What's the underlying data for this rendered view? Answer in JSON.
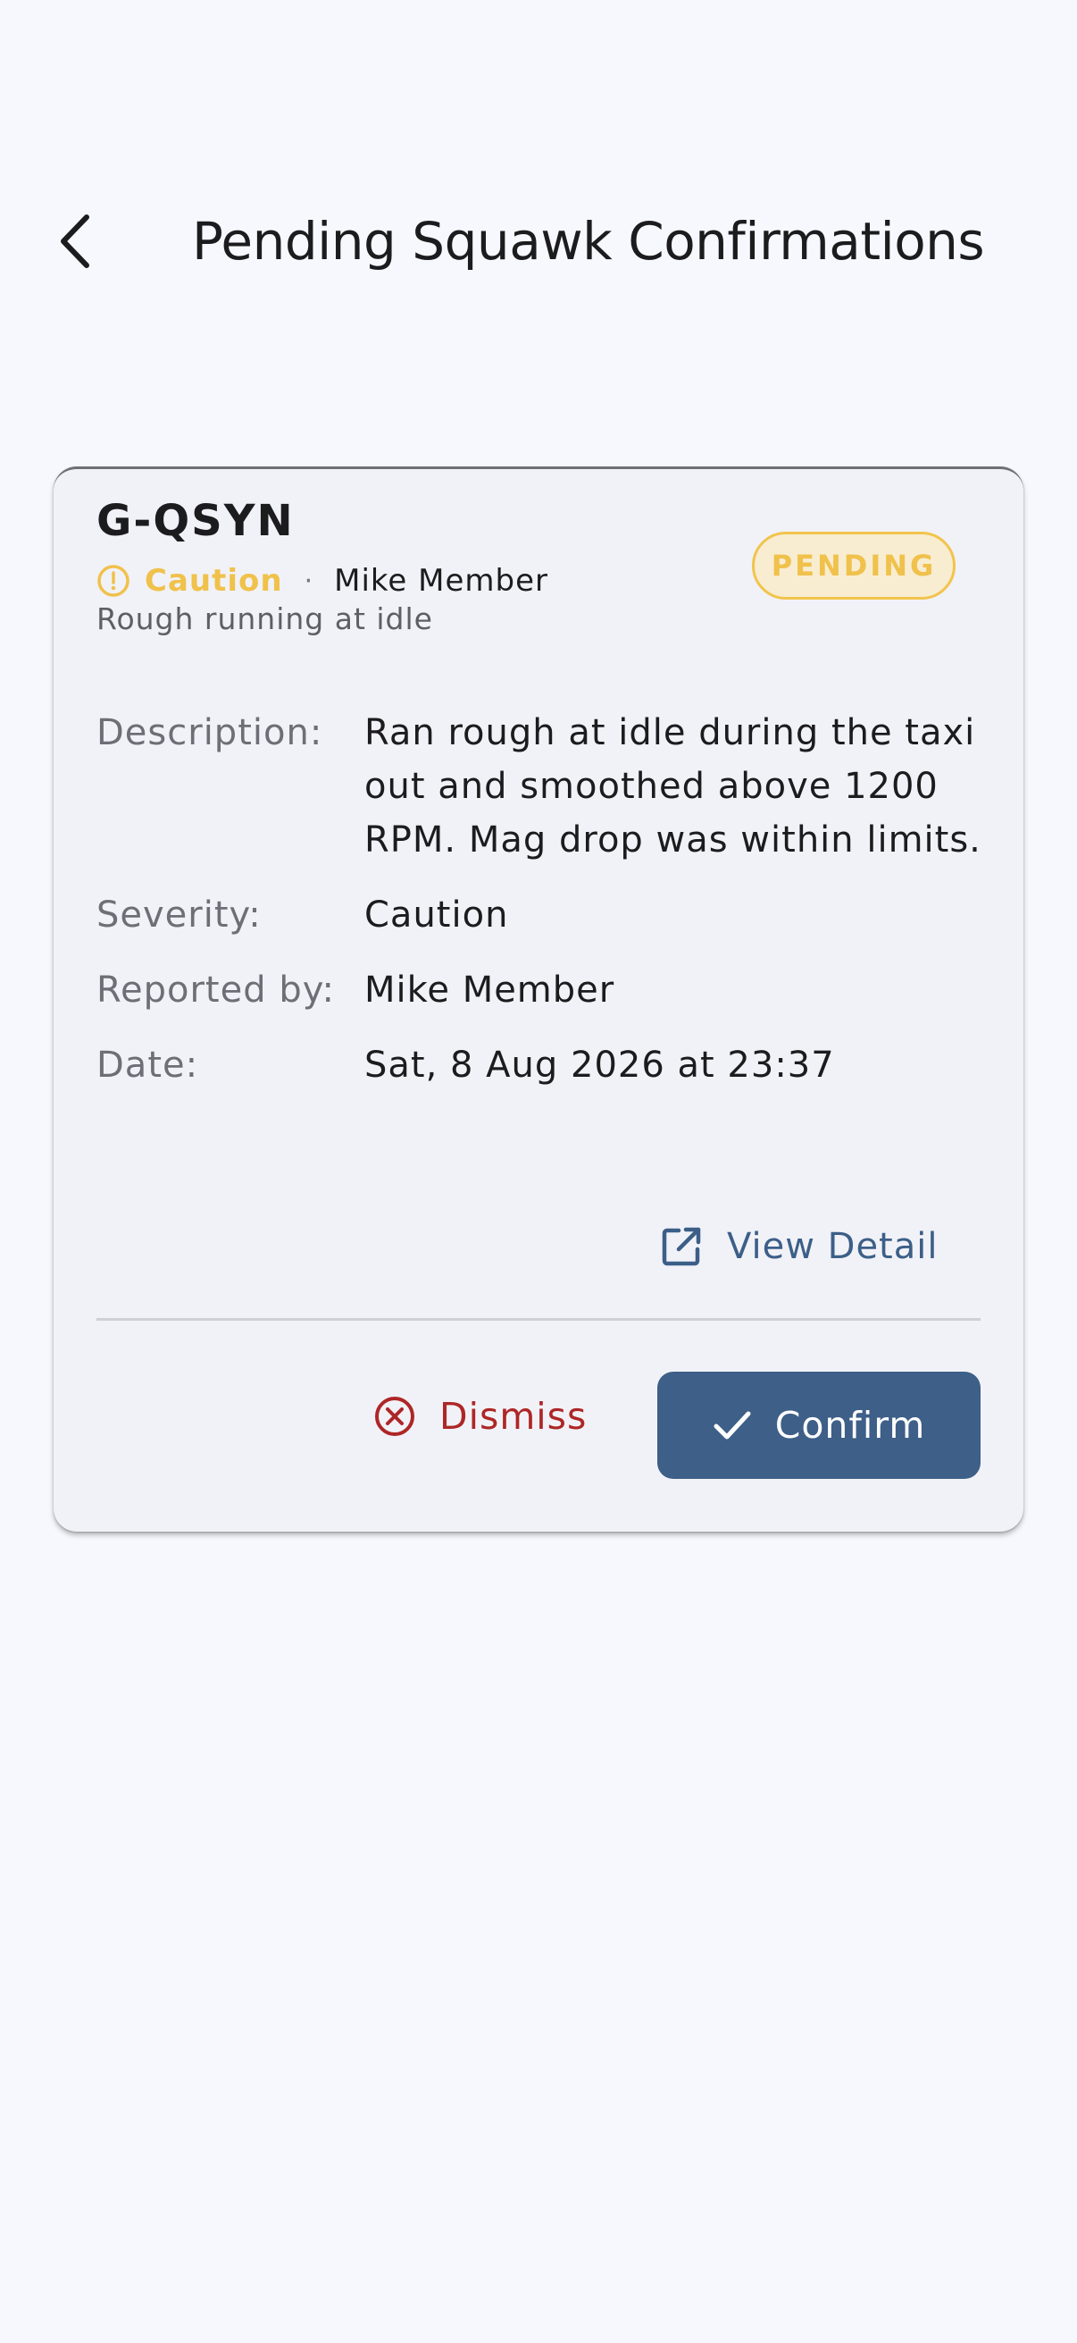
{
  "header": {
    "title": "Pending Squawk Confirmations",
    "back_icon": "chevron-left-icon"
  },
  "squawk": {
    "tail_number": "G-QSYN",
    "severity_label": "Caution",
    "severity_icon": "alert-circle-icon",
    "severity_color": "#f0c14b",
    "separator": "·",
    "reporter": "Mike Member",
    "summary": "Rough running at idle",
    "status": "PENDING",
    "status_color": "#f0c14b",
    "details": [
      {
        "label": "Description:",
        "value": "Ran rough at idle during the taxi out and smoothed above 1200 RPM. Mag drop was within limits."
      },
      {
        "label": "Severity:",
        "value": "Caution"
      },
      {
        "label": "Reported by:",
        "value": "Mike Member"
      },
      {
        "label": "Date:",
        "value": "Sat, 8 Aug 2026 at 23:37"
      }
    ],
    "view_detail_label": "View Detail",
    "view_detail_icon": "open-in-new-icon"
  },
  "actions": {
    "dismiss_label": "Dismiss",
    "dismiss_icon": "cancel-circle-icon",
    "dismiss_color": "#ae2626",
    "confirm_label": "Confirm",
    "confirm_icon": "check-icon",
    "confirm_color": "#3d5f88"
  }
}
